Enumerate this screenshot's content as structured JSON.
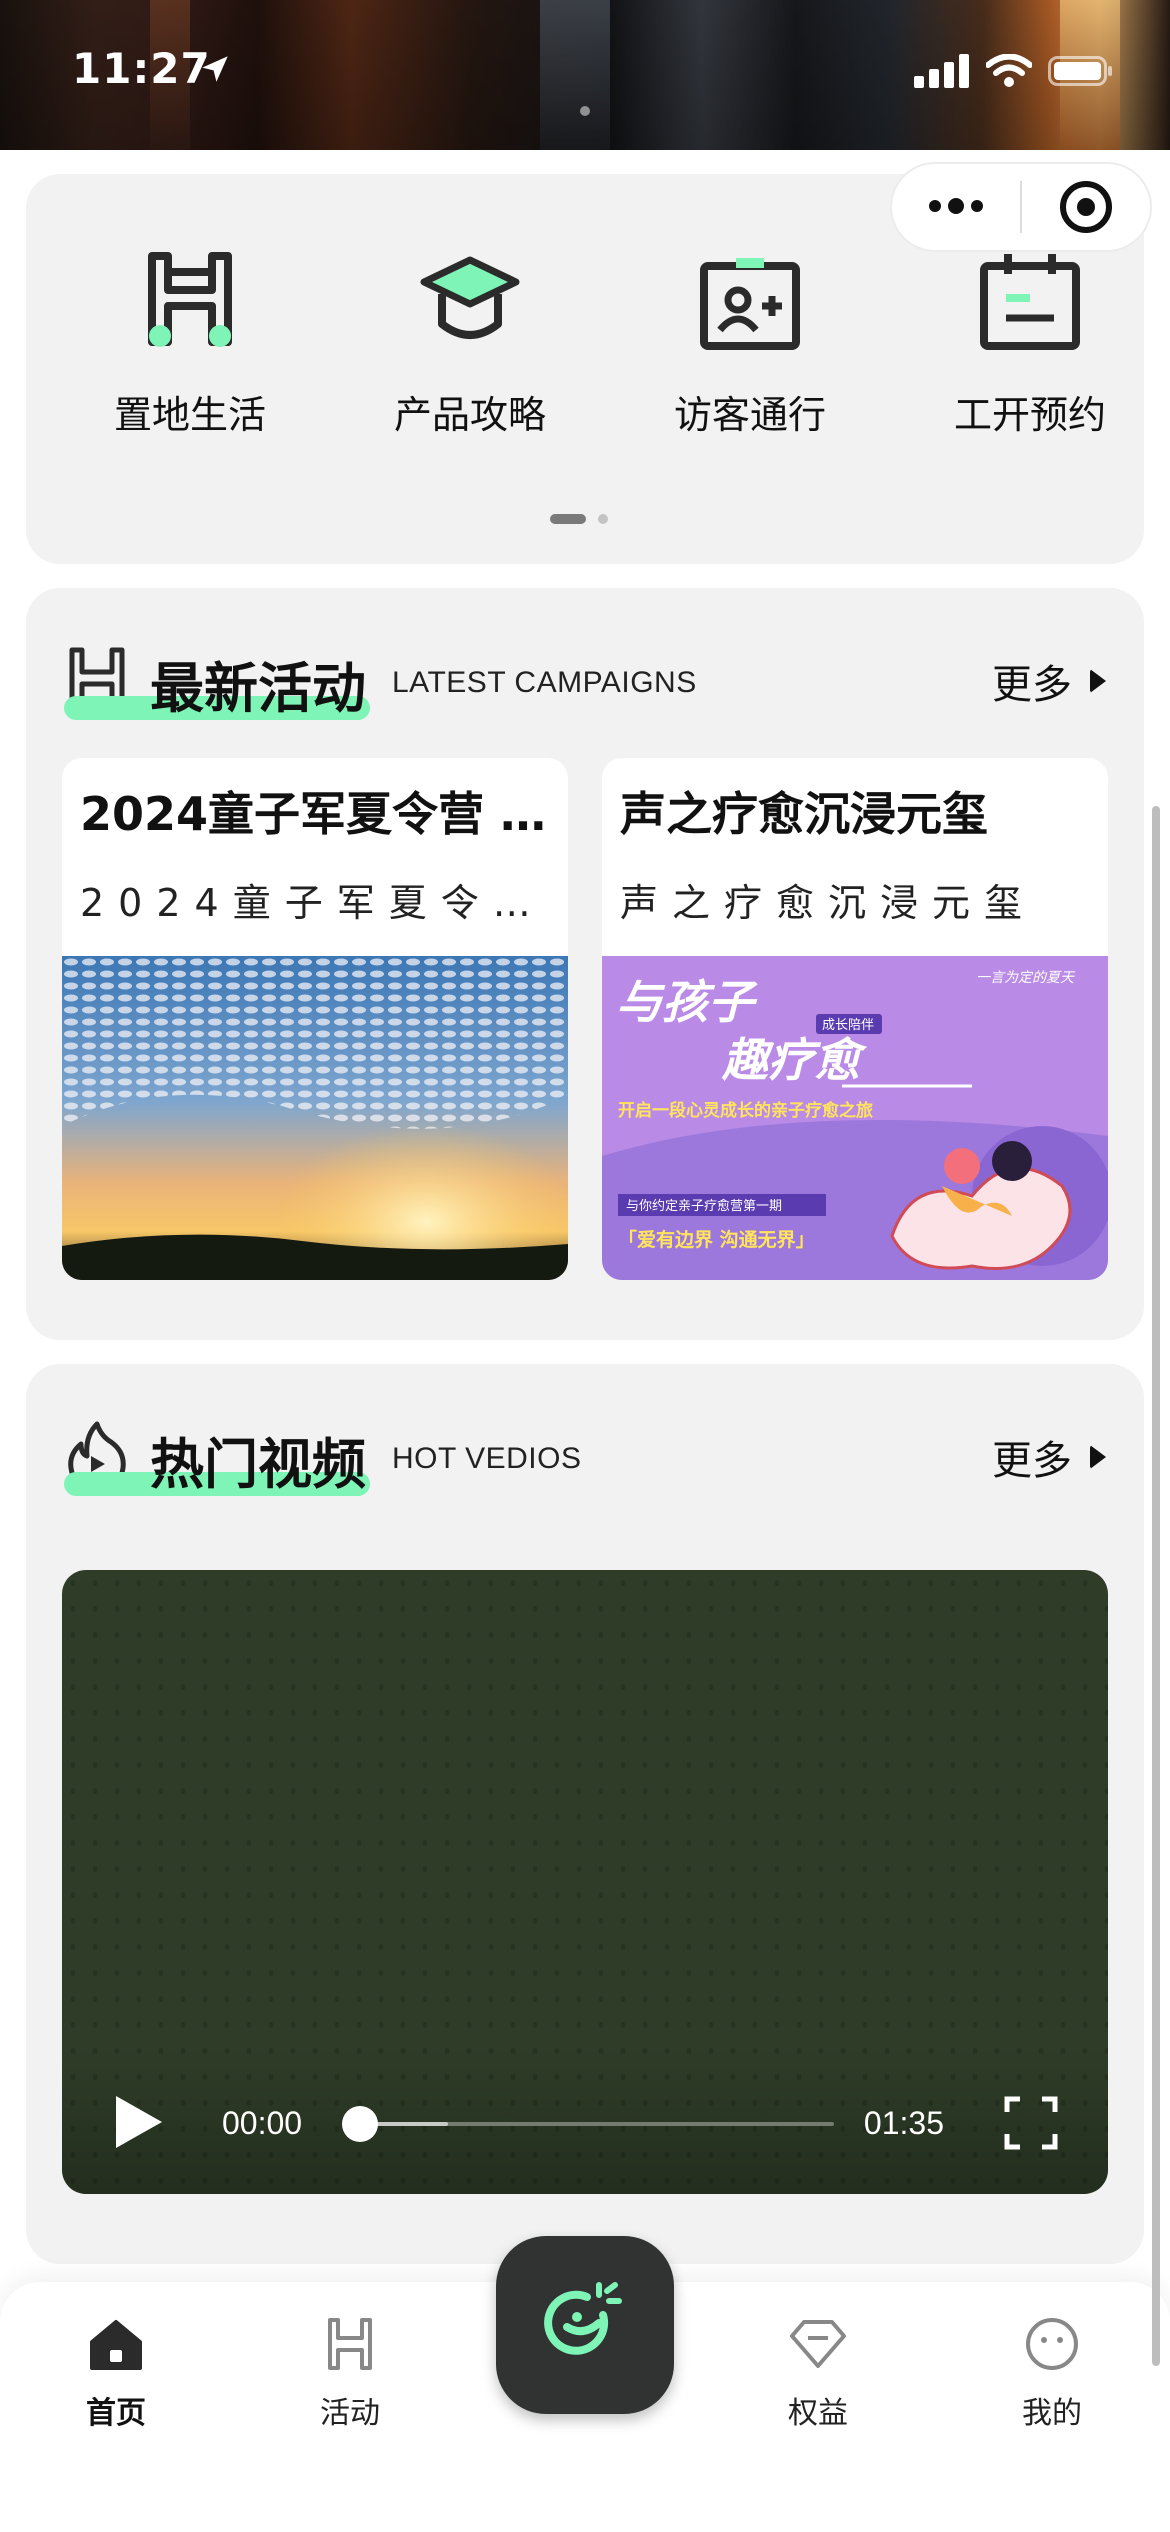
{
  "status": {
    "time": "11:27"
  },
  "quick_nav": [
    {
      "label": "置地生活",
      "icon": "binoculars-icon"
    },
    {
      "label": "产品攻略",
      "icon": "graduation-cap-icon"
    },
    {
      "label": "访客通行",
      "icon": "visitor-card-icon"
    },
    {
      "label": "工开预约",
      "icon": "calendar-icon"
    }
  ],
  "campaigns": {
    "title": "最新活动",
    "subtitle": "LATEST CAMPAIGNS",
    "more": "更多",
    "items": [
      {
        "title": "2024童子军夏令营 ...",
        "desc": "2024童子军夏令营..."
      },
      {
        "title": "声之疗愈沉浸元玺",
        "desc": "声之疗愈沉浸元玺"
      }
    ],
    "poster": {
      "line1": "与孩子",
      "badge": "成长陪伴",
      "line2": "趣疗愈",
      "tagline": "开启一段心灵成长的亲子疗愈之旅",
      "corner": "一言为定的夏天",
      "label": "与你约定亲子疗愈营第一期",
      "quote": "「爱有边界 沟通无界」"
    }
  },
  "videos": {
    "title": "热门视频",
    "subtitle": "HOT VEDIOS",
    "more": "更多",
    "current_time": "00:00",
    "duration": "01:35"
  },
  "tabbar": [
    {
      "label": "首页",
      "active": true
    },
    {
      "label": "活动",
      "active": false
    },
    {
      "label": "权益",
      "active": false
    },
    {
      "label": "我的",
      "active": false
    }
  ],
  "colors": {
    "accent": "#7ef5b6",
    "card_bg": "#f2f2f2",
    "dark": "#303331"
  }
}
